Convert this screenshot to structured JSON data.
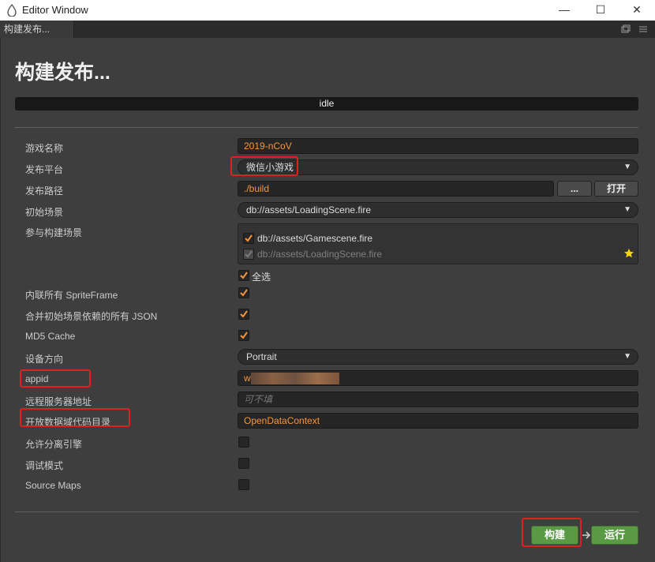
{
  "window": {
    "title": "Editor Window",
    "minimize_glyph": "—",
    "maximize_glyph": "☐",
    "close_glyph": "✕"
  },
  "tab": {
    "label": "构建发布..."
  },
  "page": {
    "title": "构建发布...",
    "status": "idle"
  },
  "form": {
    "game_name": {
      "label": "游戏名称",
      "value": "2019-nCoV"
    },
    "platform": {
      "label": "发布平台",
      "value": "微信小游戏"
    },
    "build_path": {
      "label": "发布路径",
      "value": "./build",
      "browse_label": "...",
      "open_label": "打开"
    },
    "start_scene": {
      "label": "初始场景",
      "value": "db://assets/LoadingScene.fire"
    },
    "included_scenes": {
      "label": "参与构建场景",
      "scenes": [
        "db://assets/Gamescene.fire",
        "db://assets/LoadingScene.fire"
      ],
      "select_all_label": "全选"
    },
    "inline_spriteframe": {
      "label": "内联所有 SpriteFrame",
      "checked": true
    },
    "merge_json": {
      "label": "合并初始场景依赖的所有 JSON",
      "checked": true
    },
    "md5_cache": {
      "label": "MD5 Cache",
      "checked": true
    },
    "orientation": {
      "label": "设备方向",
      "value": "Portrait"
    },
    "appid": {
      "label": "appid",
      "value": "w"
    },
    "remote_server": {
      "label": "远程服务器地址",
      "placeholder": "可不填"
    },
    "open_data_context": {
      "label": "开放数据域代码目录",
      "value": "OpenDataContext"
    },
    "separate_engine": {
      "label": "允许分离引擎",
      "checked": false
    },
    "debug_mode": {
      "label": "调试模式",
      "checked": false
    },
    "source_maps": {
      "label": "Source Maps",
      "checked": false
    }
  },
  "actions": {
    "build_label": "构建",
    "run_label": "运行"
  },
  "colors": {
    "accent": "#f7953b",
    "build_button": "#5b9a45",
    "highlight": "#e02020",
    "star": "#ffd700"
  }
}
